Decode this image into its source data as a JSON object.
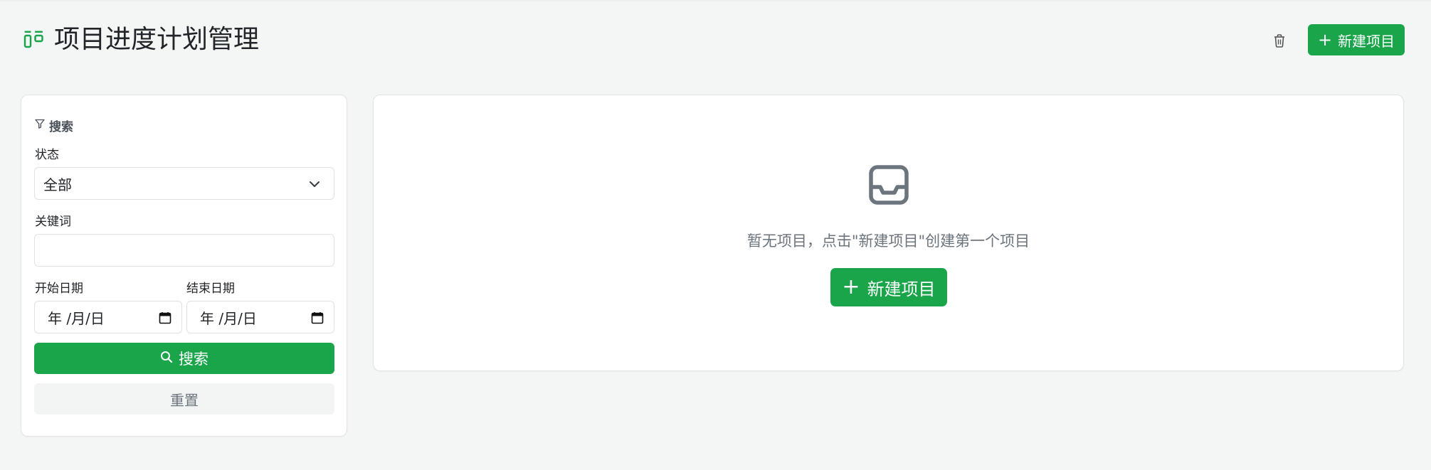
{
  "header": {
    "title": "项目进度计划管理",
    "new_project_label": "新建项目",
    "icons": {
      "app": "kanban-icon",
      "trash": "trash-icon",
      "plus": "plus-icon"
    }
  },
  "sidebar": {
    "section_title": "搜索",
    "status_label": "状态",
    "status_value": "全部",
    "keyword_label": "关键词",
    "keyword_value": "",
    "start_date_label": "开始日期",
    "end_date_label": "结束日期",
    "date_placeholder": "年 /月/日",
    "search_label": "搜索",
    "reset_label": "重置"
  },
  "main": {
    "empty_message": "暂无项目，点击\"新建项目\"创建第一个项目",
    "new_project_label": "新建项目"
  },
  "colors": {
    "accent": "#1aa54b",
    "page_bg": "#f4f6f5",
    "muted_text": "#6c757d",
    "icon_gray": "#6c757d"
  }
}
